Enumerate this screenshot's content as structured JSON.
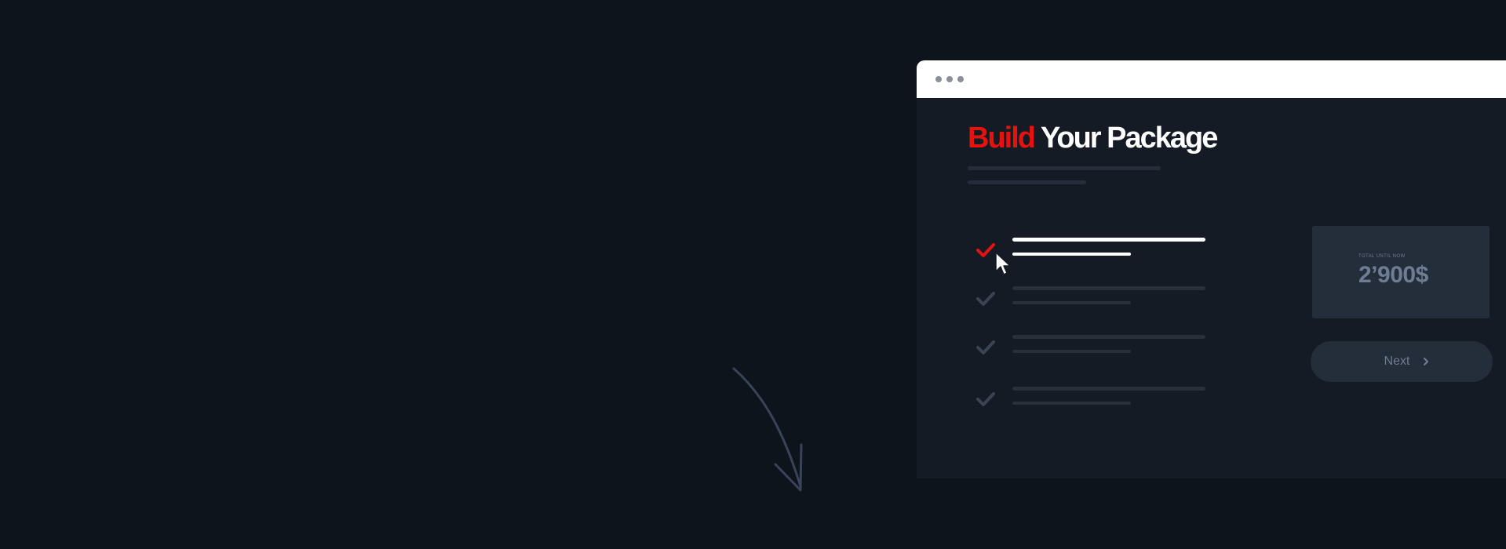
{
  "colors": {
    "background": "#0e141c",
    "panel": "#141b25",
    "accent": "#e4130f",
    "muted": "#6e7c94",
    "card": "#242d3a"
  },
  "heading": {
    "accent": "Build",
    "rest": " Your Package"
  },
  "options": [
    {
      "state": "checked",
      "icon": "checkmark-icon"
    },
    {
      "state": "unchecked",
      "icon": "checkmark-icon"
    },
    {
      "state": "unchecked",
      "icon": "checkmark-icon"
    },
    {
      "state": "unchecked",
      "icon": "checkmark-icon"
    }
  ],
  "summary": {
    "label": "TOTAL UNTIL NOW",
    "value": "2’900$"
  },
  "next_button": {
    "label": "Next",
    "icon": "chevron-right-icon"
  }
}
